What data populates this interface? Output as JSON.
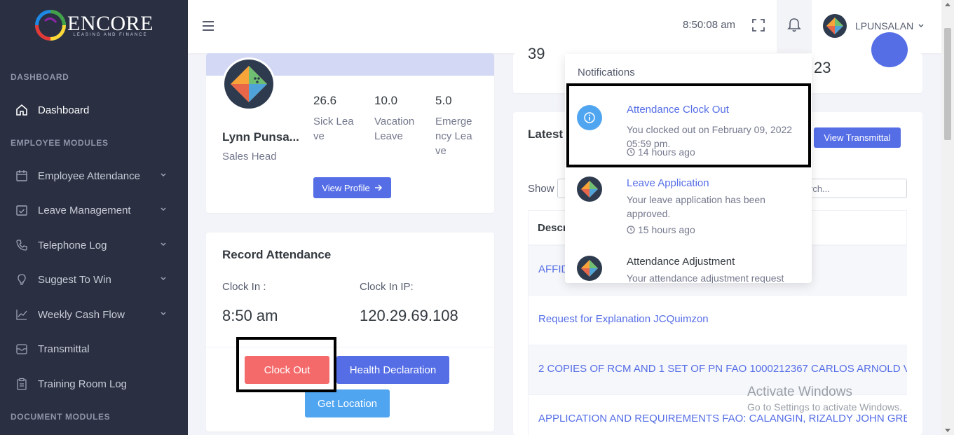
{
  "brand": {
    "name": "ENCORE",
    "tagline": "LEASING AND FINANCE"
  },
  "sidebar": {
    "sections": [
      "DASHBOARD",
      "EMPLOYEE MODULES",
      "DOCUMENT MODULES"
    ],
    "items": [
      {
        "label": "Dashboard",
        "icon": "home-icon"
      },
      {
        "label": "Employee Attendance",
        "icon": "calendar-icon"
      },
      {
        "label": "Leave Management",
        "icon": "calendar-check-icon"
      },
      {
        "label": "Telephone Log",
        "icon": "phone-icon"
      },
      {
        "label": "Suggest To Win",
        "icon": "lightbulb-icon"
      },
      {
        "label": "Weekly Cash Flow",
        "icon": "line-chart-icon"
      },
      {
        "label": "Transmittal",
        "icon": "inbox-icon"
      },
      {
        "label": "Training Room Log",
        "icon": "clipboard-icon"
      }
    ]
  },
  "topbar": {
    "time": "8:50:08 am",
    "username": "LPUNSALAN"
  },
  "profile": {
    "name": "Lynn Punsa...",
    "role": "Sales Head",
    "stats": [
      {
        "value": "26.6",
        "label": "Sick Leave"
      },
      {
        "value": "10.0",
        "label": "Vacation Leave"
      },
      {
        "value": "5.0",
        "label": "Emergency Leave"
      }
    ],
    "view_profile": "View Profile"
  },
  "attendance": {
    "title": "Record Attendance",
    "clock_in_label": "Clock In :",
    "clock_in_value": "8:50 am",
    "ip_label": "Clock In IP:",
    "ip_value": "120.29.69.108",
    "clock_out": "Clock Out",
    "health": "Health Declaration",
    "location": "Get Location"
  },
  "stats_card": {
    "left_value": "39",
    "right_value": "23"
  },
  "latest": {
    "title": "Latest",
    "view_transmittal": "View Transmittal",
    "show_label": "Show",
    "search_placeholder": "rch...",
    "column": "Descr",
    "rows": [
      "AFFID",
      "Request for Explanation JCQuimzon",
      "2 COPIES OF RCM AND 1 SET OF PN FAO 1000212367 CARLOS ARNOLD VENERACION",
      "APPLICATION AND REQUIREMENTS FAO: CALANGIN, RIZALDY JOHN GREGORIO"
    ]
  },
  "notifications": {
    "title": "Notifications",
    "items": [
      {
        "title": "Attendance Clock Out",
        "body": "You clocked out on February 09, 2022 05:59 pm.",
        "time": "14 hours ago",
        "icon": "info-icon"
      },
      {
        "title": "Leave Application",
        "body": "Your leave application has been approved.",
        "time": "15 hours ago",
        "icon": "avatar-icon"
      },
      {
        "title": "Attendance Adjustment",
        "body": "Your attendance adjustment request",
        "time": "",
        "icon": "avatar-icon"
      }
    ]
  },
  "watermark": {
    "line1": "Activate Windows",
    "line2": "Go to Settings to activate Windows."
  },
  "colors": {
    "sidebar": "#2a3042",
    "primary": "#556ee6",
    "danger": "#f46a6a",
    "info": "#50a5f1"
  }
}
